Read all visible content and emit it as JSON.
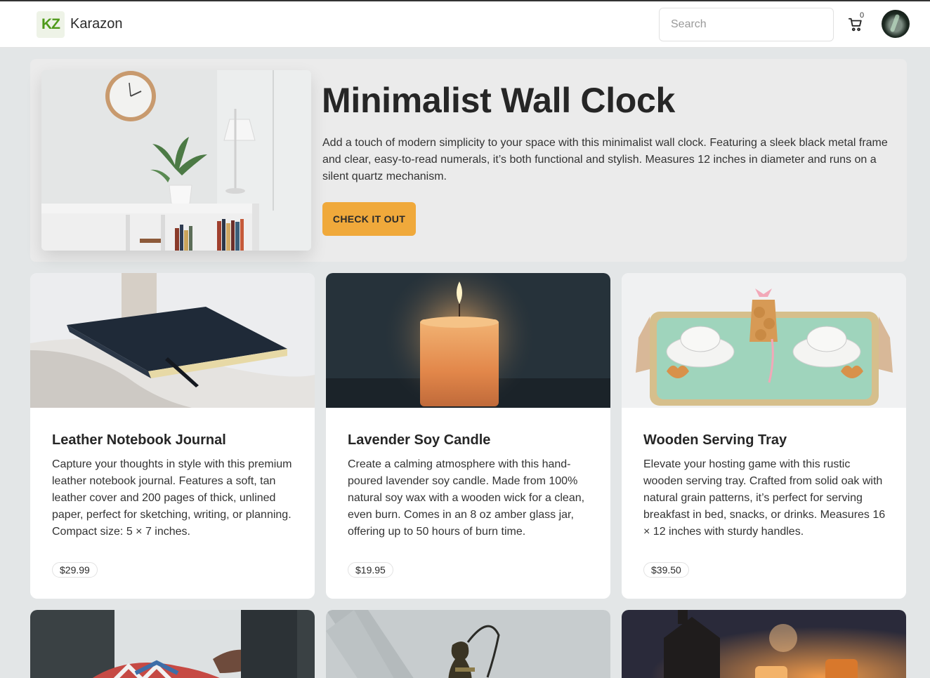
{
  "header": {
    "logo_text": "KZ",
    "brand": "Karazon",
    "search_placeholder": "Search",
    "cart_count": "0",
    "icons": [
      "cart-icon",
      "avatar"
    ]
  },
  "hero": {
    "title": "Minimalist Wall Clock",
    "description": "Add a touch of modern simplicity to your space with this minimalist wall clock. Featuring a sleek black metal frame and clear, easy-to-read numerals, it’s both functional and stylish. Measures 12 inches in diameter and runs on a silent quartz mechanism.",
    "button_label": "CHECK IT OUT"
  },
  "products": [
    {
      "title": "Leather Notebook Journal",
      "description": "Capture your thoughts in style with this premium leather notebook journal. Features a soft, tan leather cover and 200 pages of thick, unlined paper, perfect for sketching, writing, or planning. Compact size: 5 × 7 inches.",
      "price": "$29.99"
    },
    {
      "title": "Lavender Soy Candle",
      "description": "Create a calming atmosphere with this hand-poured lavender soy candle. Made from 100% natural soy wax with a wooden wick for a clean, even burn. Comes in an 8 oz amber glass jar, offering up to 50 hours of burn time.",
      "price": "$19.95"
    },
    {
      "title": "Wooden Serving Tray",
      "description": "Elevate your hosting game with this rustic wooden serving tray. Crafted from solid oak with natural grain patterns, it’s perfect for serving breakfast in bed, snacks, or drinks. Measures 16 × 12 inches with sturdy handles.",
      "price": "$39.50"
    }
  ],
  "colors": {
    "accent": "#f0a93b",
    "logo_green": "#4f9a1a",
    "background": "#e3e6e7"
  }
}
